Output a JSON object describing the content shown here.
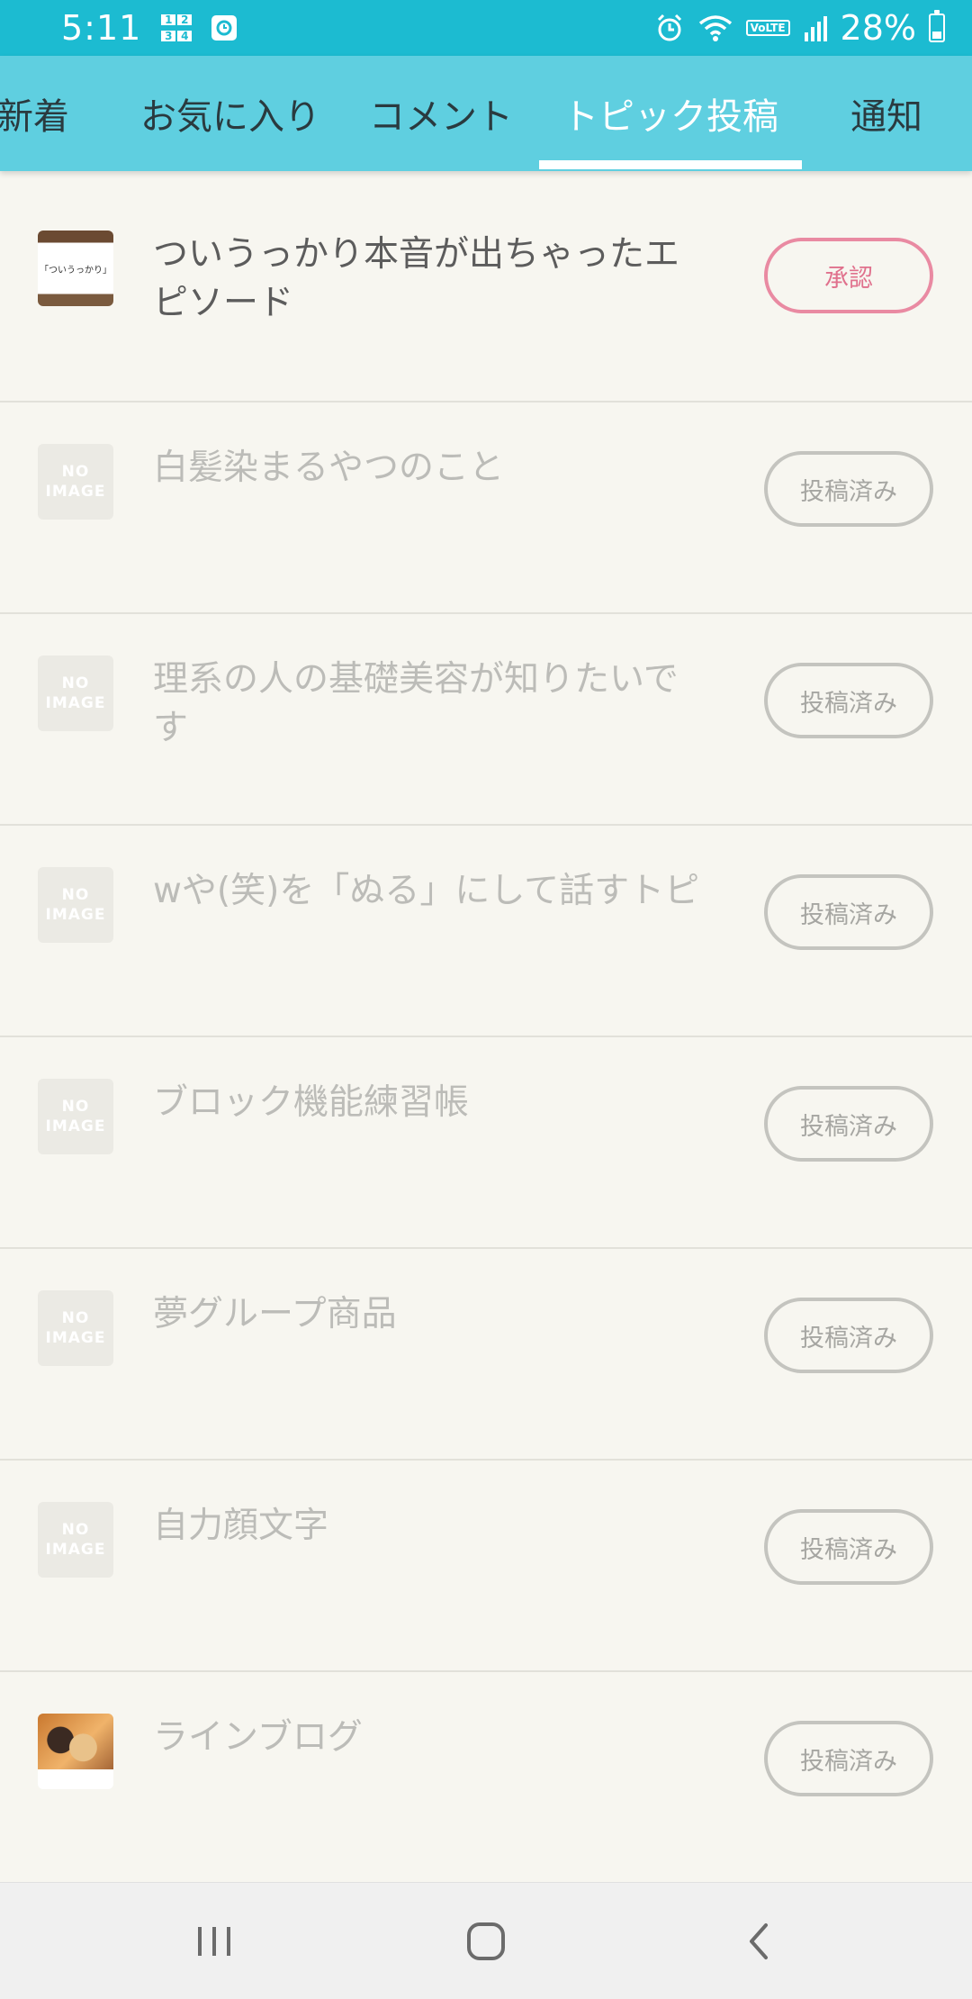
{
  "status_bar": {
    "time": "5:11",
    "battery": "28%",
    "network": "VoLTE",
    "calc_digits": [
      "1",
      "2",
      "3",
      "4"
    ]
  },
  "tabs": [
    {
      "label": "新着",
      "active": false
    },
    {
      "label": "お気に入り",
      "active": false
    },
    {
      "label": "コメント",
      "active": false
    },
    {
      "label": "トピック投稿",
      "active": true
    },
    {
      "label": "通知",
      "active": false
    }
  ],
  "no_image": {
    "line1": "NO",
    "line2": "IMAGE"
  },
  "topics": [
    {
      "title": "ついうっかり本音が出ちゃったエピソード",
      "status": "承認",
      "thumbnail": "photo",
      "thumb_caption": "「ついうっかり」"
    },
    {
      "title": "白髪染まるやつのこと",
      "status": "投稿済み",
      "thumbnail": "no-image"
    },
    {
      "title": "理系の人の基礎美容が知りたいです",
      "status": "投稿済み",
      "thumbnail": "no-image"
    },
    {
      "title": "wや(笑)を「ぬる」にして話すトピ",
      "status": "投稿済み",
      "thumbnail": "no-image"
    },
    {
      "title": "ブロック機能練習帳",
      "status": "投稿済み",
      "thumbnail": "no-image"
    },
    {
      "title": "夢グループ商品",
      "status": "投稿済み",
      "thumbnail": "no-image"
    },
    {
      "title": "自力顔文字",
      "status": "投稿済み",
      "thumbnail": "no-image"
    },
    {
      "title": "ラインブログ",
      "status": "投稿済み",
      "thumbnail": "photo"
    }
  ],
  "colors": {
    "status_bar": "#1cbbd1",
    "tab_bar": "#5fcfe0",
    "background": "#f7f6f0",
    "approve_accent": "#e0718d"
  }
}
